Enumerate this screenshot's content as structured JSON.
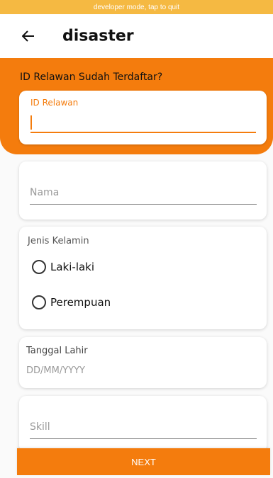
{
  "dev_banner": "developer mode, tap to quit",
  "app_bar": {
    "title": "disaster",
    "back_icon": "arrow-left-icon"
  },
  "id_section": {
    "heading": "ID Relawan Sudah Terdaftar?",
    "label": "ID Relawan",
    "value": ""
  },
  "nama": {
    "placeholder": "Nama"
  },
  "gender": {
    "title": "Jenis Kelamin",
    "options": [
      {
        "label": "Laki-laki",
        "selected": false
      },
      {
        "label": "Perempuan",
        "selected": false
      }
    ]
  },
  "dob": {
    "title": "Tanggal Lahir",
    "placeholder": "DD/MM/YYYY"
  },
  "skill": {
    "placeholder": "Skill"
  },
  "next_button": {
    "label": "NEXT"
  },
  "colors": {
    "accent": "#f47c0d",
    "dev_banner": "#f5b942"
  }
}
